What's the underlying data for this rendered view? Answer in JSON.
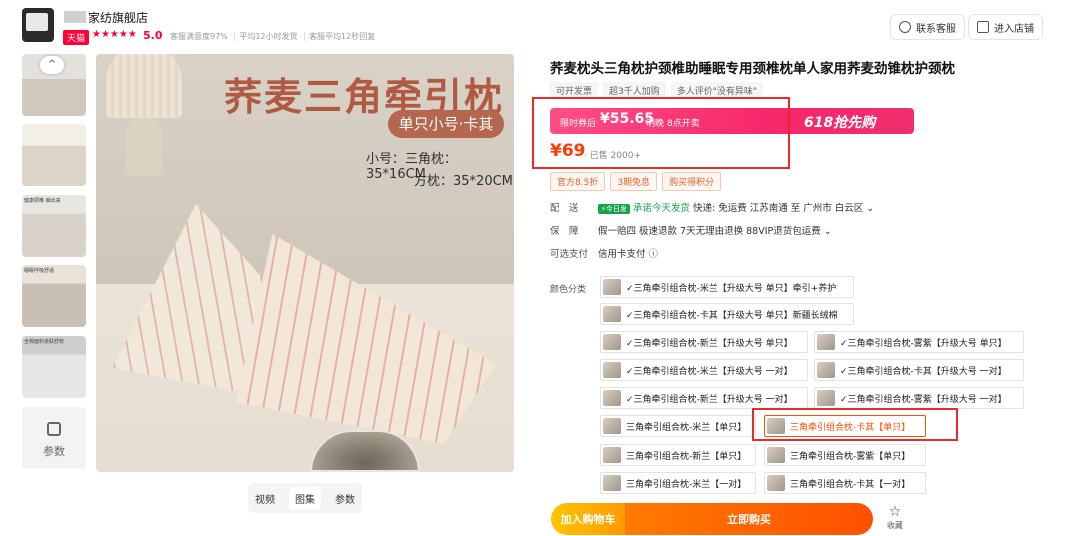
{
  "shop": {
    "name_suffix": "家纺旗舰店",
    "badge": "天猫",
    "rating": "5.0",
    "stars": "★★★★★",
    "stats": [
      "客服满意度97%",
      "平均12小时发货",
      "客服平均12秒回复"
    ],
    "contact_label": "联系客服",
    "enter_label": "进入店铺"
  },
  "gallery": {
    "thumb_captions": [
      "",
      "",
      "健康颈椎 躺出来",
      "睡眠呼吸舒适",
      "全棉面料亲肤舒软"
    ],
    "params_label": "参数",
    "up_arrow": "^",
    "image_title": "荞麦三角牵引枕",
    "image_pill": "单只小号·卡其",
    "image_line1": "小号：三角枕：35*16CM",
    "image_line2": "方枕：35*20CM",
    "tabs": [
      "视频",
      "图集",
      "参数"
    ],
    "active_tab": "图集"
  },
  "product": {
    "title": "荞麦枕头三角枕护颈椎助睡眠专用颈椎枕单人家用荞麦劲锥枕护颈枕",
    "chips": [
      "可开发票",
      "超3千人加购",
      "多人评价\"没有异味\""
    ],
    "promo_label": "限时券后",
    "promo_price": "¥55.65",
    "promo_time": "明晚 8点开卖",
    "promo_event": "618抢先购",
    "price": "¥69",
    "sold": "· 已售 2000+",
    "tags": [
      "官方8.5折",
      "3期免息",
      "购买得积分"
    ],
    "delivery_key": "配　送",
    "delivery_badge": "⚡今日发",
    "delivery_promise": "承诺今天发货",
    "delivery_rest": "快递: 免运费  江苏南通  至  广州市 白云区 ⌄",
    "guarantee_key": "保　障",
    "guarantee_val": "假一赔四   极速退款   7天无理由退换   88VIP退货包运费 ⌄",
    "pay_key": "可选支付",
    "pay_val": "信用卡支付 ⓘ",
    "color_label": "颜色分类",
    "skus": [
      "✓三角牵引组合枕-米兰【升级大号 单只】牵引+养护",
      "✓三角牵引组合枕-卡其【升级大号 单只】新疆长绒棉",
      "✓三角牵引组合枕-新兰【升级大号 单只】",
      "✓三角牵引组合枕-雾紫【升级大号 单只】",
      "✓三角牵引组合枕-米兰【升级大号 一对】",
      "✓三角牵引组合枕-卡其【升级大号 一对】",
      "✓三角牵引组合枕-新兰【升级大号 一对】",
      "✓三角牵引组合枕-雾紫【升级大号 一对】",
      "三角牵引组合枕-米兰【单只】",
      "三角牵引组合枕-卡其【单只】",
      "三角牵引组合枕-新兰【单只】",
      "三角牵引组合枕-雾紫【单只】",
      "三角牵引组合枕-米兰【一对】",
      "三角牵引组合枕-卡其【一对】"
    ],
    "add_cart": "加入购物车",
    "buy_now": "立即购买",
    "fav_label": "收藏",
    "fav_icon": "☆"
  }
}
